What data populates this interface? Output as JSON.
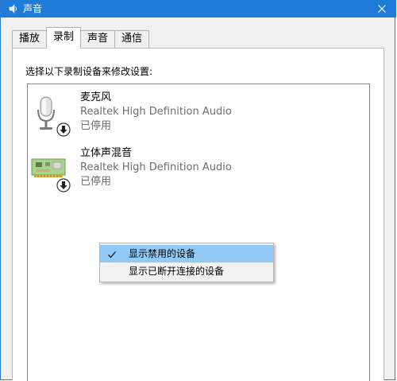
{
  "window": {
    "title": "声音",
    "accent_color": "#1e7cd8",
    "close_icon": "close-icon"
  },
  "tabs": [
    {
      "label": "播放",
      "active": false
    },
    {
      "label": "录制",
      "active": true
    },
    {
      "label": "声音",
      "active": false
    },
    {
      "label": "通信",
      "active": false
    }
  ],
  "panel": {
    "instruction": "选择以下录制设备来修改设置:"
  },
  "devices": [
    {
      "name": "麦克风",
      "driver": "Realtek High Definition Audio",
      "status": "已停用",
      "icon": "microphone-icon",
      "badge": "disabled-down-arrow-icon"
    },
    {
      "name": "立体声混音",
      "driver": "Realtek High Definition Audio",
      "status": "已停用",
      "icon": "sound-card-icon",
      "badge": "disabled-down-arrow-icon"
    }
  ],
  "context_menu": {
    "items": [
      {
        "label": "显示禁用的设备",
        "checked": true,
        "highlighted": true
      },
      {
        "label": "显示已断开连接的设备",
        "checked": false,
        "highlighted": false
      }
    ],
    "highlight_color": "#91c9f7"
  }
}
